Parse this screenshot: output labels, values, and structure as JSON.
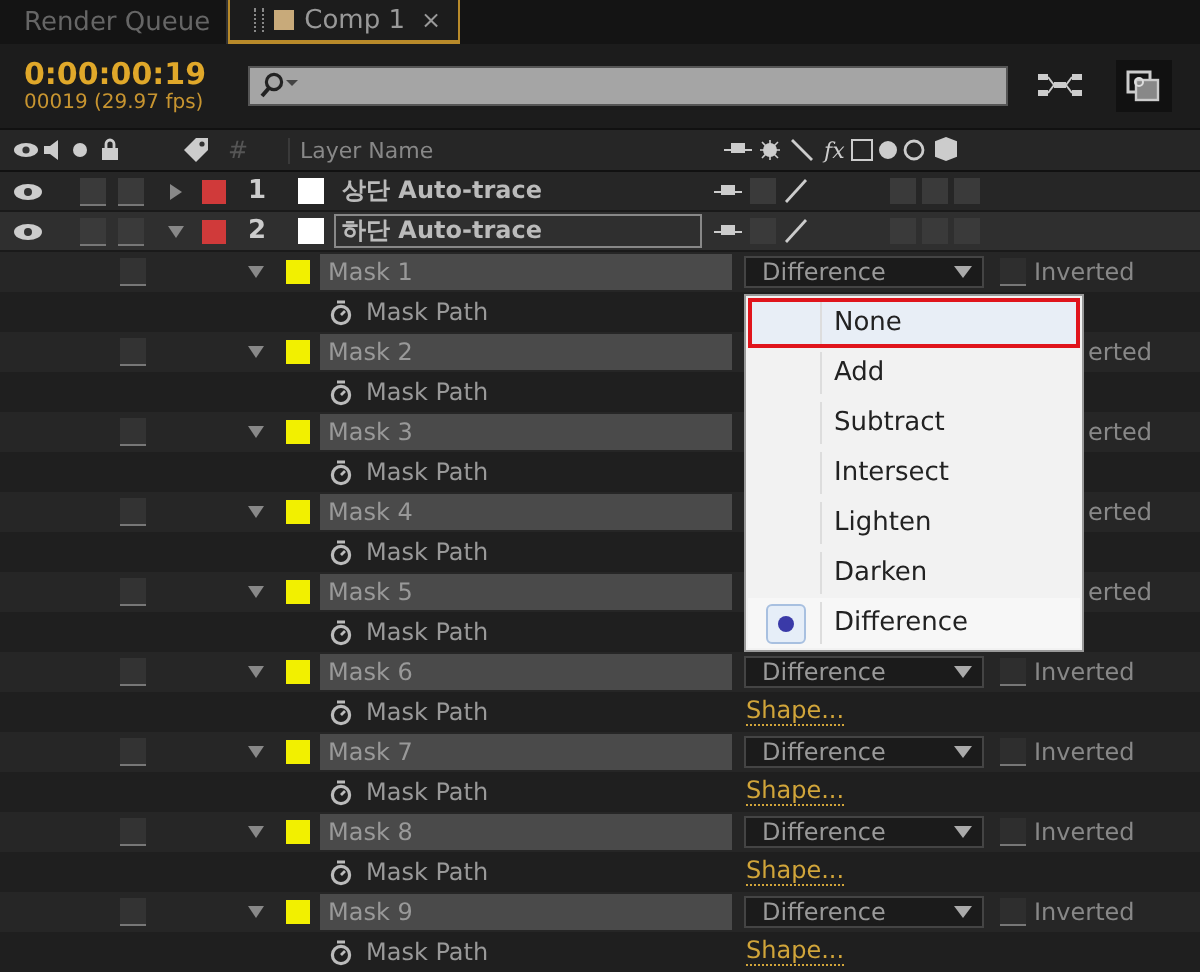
{
  "tabs": [
    {
      "label": "Render Queue",
      "selected": false
    },
    {
      "label": "Comp 1",
      "selected": true,
      "close": "×"
    }
  ],
  "timecode": "0:00:00:19",
  "frame_info": "00019 (29.97 fps)",
  "columns": {
    "number": "#",
    "layer_name": "Layer Name",
    "effects_switch": "fx"
  },
  "layers": [
    {
      "number": "1",
      "color": "#d03a3a",
      "name": "상단 Auto-trace",
      "expanded": false,
      "selected": false,
      "visible": true
    },
    {
      "number": "2",
      "color": "#d03a3a",
      "name": "하단 Auto-trace",
      "expanded": true,
      "selected": true,
      "visible": true
    }
  ],
  "masks": [
    {
      "name": "Mask 1",
      "color": "#f2f000",
      "expanded": true,
      "mode": "Difference",
      "inverted": false,
      "inverted_label": "Inverted",
      "property": "Mask Path"
    },
    {
      "name": "Mask 2",
      "color": "#f2f000",
      "expanded": true,
      "inverted_label": "erted",
      "property": "Mask Path"
    },
    {
      "name": "Mask 3",
      "color": "#f2f000",
      "expanded": true,
      "inverted_label": "erted",
      "property": "Mask Path"
    },
    {
      "name": "Mask 4",
      "color": "#f2f000",
      "expanded": true,
      "inverted_label": "erted",
      "property": "Mask Path"
    },
    {
      "name": "Mask 5",
      "color": "#f2f000",
      "expanded": true,
      "inverted_label": "erted",
      "property": "Mask Path"
    },
    {
      "name": "Mask 6",
      "color": "#f2f000",
      "expanded": true,
      "mode": "Difference",
      "inverted": false,
      "inverted_label": "Inverted",
      "property": "Mask Path",
      "value": "Shape..."
    },
    {
      "name": "Mask 7",
      "color": "#f2f000",
      "expanded": true,
      "mode": "Difference",
      "inverted": false,
      "inverted_label": "Inverted",
      "property": "Mask Path",
      "value": "Shape..."
    },
    {
      "name": "Mask 8",
      "color": "#f2f000",
      "expanded": true,
      "mode": "Difference",
      "inverted": false,
      "inverted_label": "Inverted",
      "property": "Mask Path",
      "value": "Shape..."
    },
    {
      "name": "Mask 9",
      "color": "#f2f000",
      "expanded": true,
      "mode": "Difference",
      "inverted": false,
      "inverted_label": "Inverted",
      "property": "Mask Path",
      "value": "Shape..."
    }
  ],
  "blend_menu": {
    "items": [
      {
        "label": "None",
        "selected": false,
        "highlighted": true
      },
      {
        "label": "Add",
        "selected": false,
        "highlighted": false
      },
      {
        "label": "Subtract",
        "selected": false,
        "highlighted": false
      },
      {
        "label": "Intersect",
        "selected": false,
        "highlighted": false
      },
      {
        "label": "Lighten",
        "selected": false,
        "highlighted": false
      },
      {
        "label": "Darken",
        "selected": false,
        "highlighted": false
      },
      {
        "label": "Difference",
        "selected": true,
        "highlighted": false
      }
    ]
  }
}
